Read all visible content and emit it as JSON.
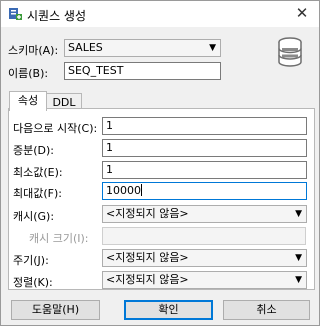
{
  "window": {
    "title": "시퀀스 생성"
  },
  "icons": {
    "title": "sequence-create-icon",
    "close": "close-icon",
    "db": "database-icon"
  },
  "schema": {
    "label": "스키마(A):",
    "value": "SALES"
  },
  "name": {
    "label": "이름(B):",
    "value": "SEQ_TEST"
  },
  "tabs": [
    {
      "label": "속성"
    },
    {
      "label": "DDL"
    }
  ],
  "fields": {
    "start": {
      "label": "다음으로 시작(C):",
      "value": "1"
    },
    "increment": {
      "label": "증분(D):",
      "value": "1"
    },
    "min": {
      "label": "최소값(E):",
      "value": "1"
    },
    "max": {
      "label": "최대값(F):",
      "value": "10000"
    },
    "cache": {
      "label": "캐시(G):",
      "value": "<지정되지 않음>"
    },
    "cache_size": {
      "label": "캐시 크기(I):"
    },
    "cycle": {
      "label": "주기(J):",
      "value": "<지정되지 않음>"
    },
    "order": {
      "label": "정렬(K):",
      "value": "<지정되지 않음>"
    }
  },
  "buttons": {
    "help": "도움말(H)",
    "ok": "확인",
    "cancel": "취소"
  },
  "colors": {
    "accent": "#0078d7",
    "db_icon": "#7a7a7a"
  }
}
